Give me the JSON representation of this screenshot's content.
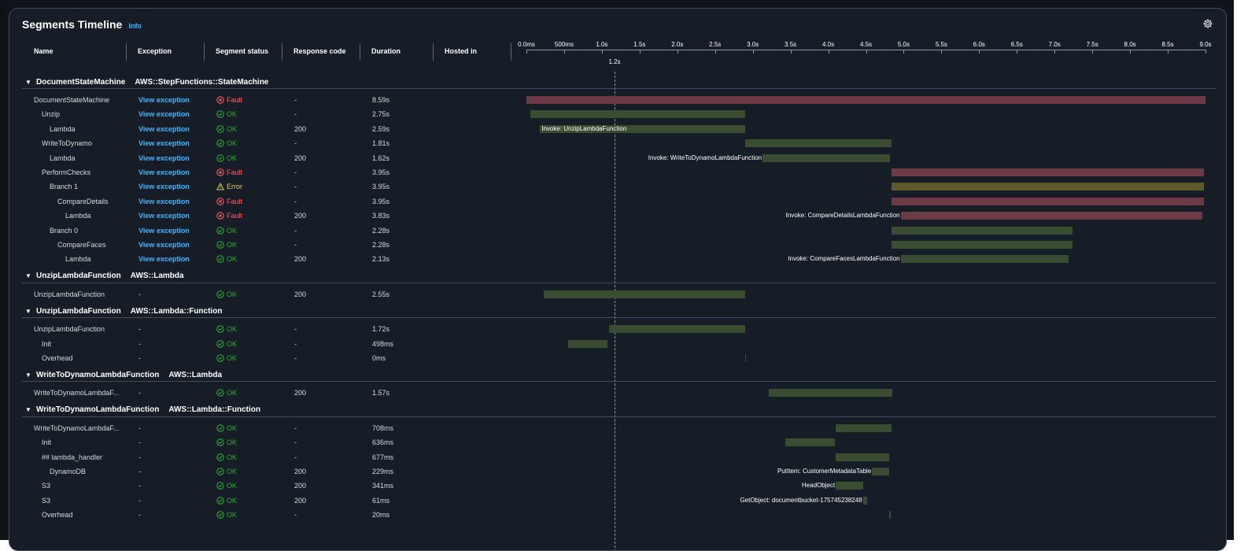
{
  "panel": {
    "title": "Segments Timeline",
    "info": "Info"
  },
  "columns": {
    "name": "Name",
    "exception": "Exception",
    "status": "Segment status",
    "response": "Response code",
    "duration": "Duration",
    "hosted": "Hosted in"
  },
  "axis": {
    "ticks": [
      "0.0ms",
      "500ms",
      "1.0s",
      "1.5s",
      "2.0s",
      "2.5s",
      "3.0s",
      "3.5s",
      "4.0s",
      "4.5s",
      "5.0s",
      "5.5s",
      "6.0s",
      "6.5s",
      "7.0s",
      "7.5s",
      "8.0s",
      "8.5s",
      "9.0s"
    ],
    "cursor": "1.2s"
  },
  "colors": {
    "ok": "#29ad32",
    "fault": "#ff5d64",
    "error": "#e0ca57",
    "link": "#42b4ff"
  },
  "groups": [
    {
      "name": "DocumentStateMachine",
      "type": "AWS::StepFunctions::StateMachine",
      "rows": [
        {
          "name": "DocumentStateMachine",
          "indent": 0,
          "exception": "View exception",
          "status": "Fault",
          "response": "-",
          "duration": "8.59s",
          "start": 0.0,
          "end": 9.0,
          "label": ""
        },
        {
          "name": "Unzip",
          "indent": 1,
          "exception": "View exception",
          "status": "OK",
          "response": "-",
          "duration": "2.75s",
          "start": 0.05,
          "end": 2.9,
          "label": ""
        },
        {
          "name": "Lambda",
          "indent": 2,
          "exception": "View exception",
          "status": "OK",
          "response": "200",
          "duration": "2.59s",
          "start": 0.18,
          "end": 2.9,
          "label": "Invoke: UnzipLambdaFunction"
        },
        {
          "name": "WriteToDynamo",
          "indent": 1,
          "exception": "View exception",
          "status": "OK",
          "response": "-",
          "duration": "1.81s",
          "start": 2.9,
          "end": 4.84,
          "label": ""
        },
        {
          "name": "Lambda",
          "indent": 2,
          "exception": "View exception",
          "status": "OK",
          "response": "200",
          "duration": "1.62s",
          "start": 3.13,
          "end": 4.82,
          "label": "Invoke: WriteToDynamoLambdaFunction"
        },
        {
          "name": "PerformChecks",
          "indent": 1,
          "exception": "View exception",
          "status": "Fault",
          "response": "-",
          "duration": "3.95s",
          "start": 4.84,
          "end": 8.98,
          "label": ""
        },
        {
          "name": "Branch 1",
          "indent": 2,
          "exception": "View exception",
          "status": "Error",
          "response": "-",
          "duration": "3.95s",
          "start": 4.84,
          "end": 8.98,
          "label": ""
        },
        {
          "name": "CompareDetails",
          "indent": 3,
          "exception": "View exception",
          "status": "Fault",
          "response": "-",
          "duration": "3.95s",
          "start": 4.84,
          "end": 8.98,
          "label": ""
        },
        {
          "name": "Lambda",
          "indent": 4,
          "exception": "View exception",
          "status": "Fault",
          "response": "200",
          "duration": "3.83s",
          "start": 4.96,
          "end": 8.96,
          "label": "Invoke: CompareDetailsLambdaFunction"
        },
        {
          "name": "Branch 0",
          "indent": 2,
          "exception": "View exception",
          "status": "OK",
          "response": "-",
          "duration": "2.28s",
          "start": 4.84,
          "end": 7.24,
          "label": ""
        },
        {
          "name": "CompareFaces",
          "indent": 3,
          "exception": "View exception",
          "status": "OK",
          "response": "-",
          "duration": "2.28s",
          "start": 4.84,
          "end": 7.24,
          "label": ""
        },
        {
          "name": "Lambda",
          "indent": 4,
          "exception": "View exception",
          "status": "OK",
          "response": "200",
          "duration": "2.13s",
          "start": 4.96,
          "end": 7.19,
          "label": "Invoke: CompareFacesLambdaFunction"
        }
      ]
    },
    {
      "name": "UnzipLambdaFunction",
      "type": "AWS::Lambda",
      "rows": [
        {
          "name": "UnzipLambdaFunction",
          "indent": 0,
          "exception": "-",
          "status": "OK",
          "response": "200",
          "duration": "2.55s",
          "start": 0.23,
          "end": 2.9,
          "label": ""
        }
      ]
    },
    {
      "name": "UnzipLambdaFunction",
      "type": "AWS::Lambda::Function",
      "rows": [
        {
          "name": "UnzipLambdaFunction",
          "indent": 0,
          "exception": "-",
          "status": "OK",
          "response": "-",
          "duration": "1.72s",
          "start": 1.1,
          "end": 2.9,
          "label": ""
        },
        {
          "name": "Init",
          "indent": 1,
          "exception": "-",
          "status": "OK",
          "response": "-",
          "duration": "498ms",
          "start": 0.55,
          "end": 1.07,
          "label": ""
        },
        {
          "name": "Overhead",
          "indent": 1,
          "exception": "-",
          "status": "OK",
          "response": "-",
          "duration": "0ms",
          "start": 2.9,
          "end": 2.9,
          "label": ""
        }
      ]
    },
    {
      "name": "WriteToDynamoLambdaFunction",
      "type": "AWS::Lambda",
      "rows": [
        {
          "name": "WriteToDynamoLambdaF...",
          "indent": 0,
          "exception": "-",
          "status": "OK",
          "response": "200",
          "duration": "1.57s",
          "start": 3.21,
          "end": 4.85,
          "label": ""
        }
      ]
    },
    {
      "name": "WriteToDynamoLambdaFunction",
      "type": "AWS::Lambda::Function",
      "rows": [
        {
          "name": "WriteToDynamoLambdaF...",
          "indent": 0,
          "exception": "-",
          "status": "OK",
          "response": "-",
          "duration": "708ms",
          "start": 4.1,
          "end": 4.84,
          "label": ""
        },
        {
          "name": "Init",
          "indent": 1,
          "exception": "-",
          "status": "OK",
          "response": "-",
          "duration": "636ms",
          "start": 3.43,
          "end": 4.09,
          "label": ""
        },
        {
          "name": "## lambda_handler",
          "indent": 1,
          "exception": "-",
          "status": "OK",
          "response": "-",
          "duration": "677ms",
          "start": 4.1,
          "end": 4.81,
          "label": ""
        },
        {
          "name": "DynamoDB",
          "indent": 2,
          "exception": "-",
          "status": "OK",
          "response": "200",
          "duration": "229ms",
          "start": 4.58,
          "end": 4.81,
          "label": "PutItem: CustomerMetadataTable"
        },
        {
          "name": "S3",
          "indent": 1,
          "exception": "-",
          "status": "OK",
          "response": "200",
          "duration": "341ms",
          "start": 4.1,
          "end": 4.46,
          "label": "HeadObject"
        },
        {
          "name": "S3",
          "indent": 1,
          "exception": "-",
          "status": "OK",
          "response": "200",
          "duration": "61ms",
          "start": 4.46,
          "end": 4.52,
          "label": "GetObject: documentbucket-175745238248"
        },
        {
          "name": "Overhead",
          "indent": 1,
          "exception": "-",
          "status": "OK",
          "response": "-",
          "duration": "20ms",
          "start": 4.81,
          "end": 4.83,
          "label": ""
        }
      ]
    }
  ]
}
